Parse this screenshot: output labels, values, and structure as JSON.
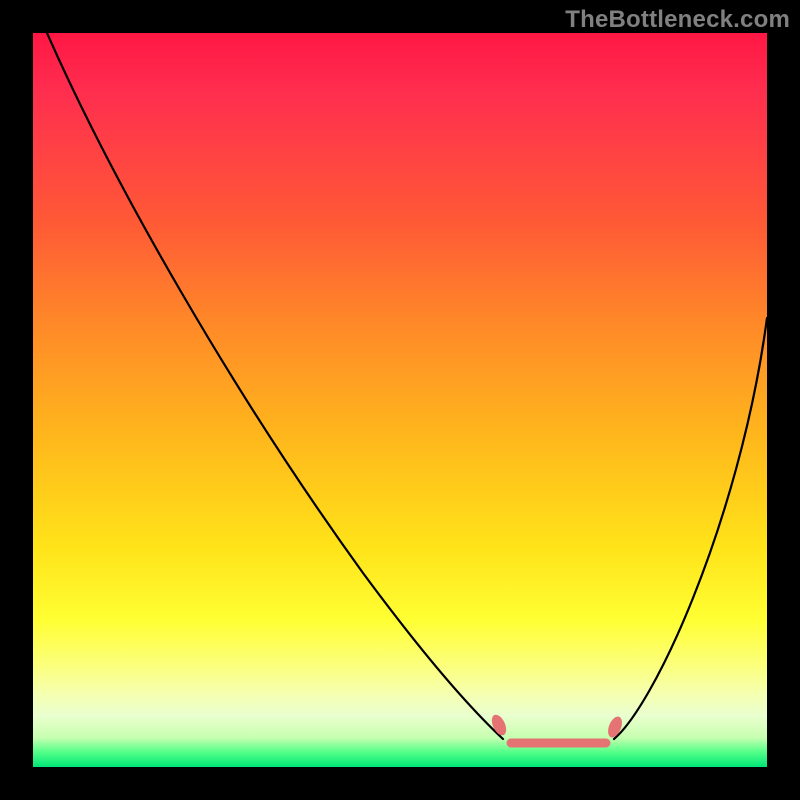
{
  "watermark": "TheBottleneck.com",
  "chart_data": {
    "type": "line",
    "title": "",
    "xlabel": "",
    "ylabel": "",
    "xlim": [
      0,
      100
    ],
    "ylim": [
      0,
      100
    ],
    "grid": false,
    "curves": {
      "left": {
        "description": "descending curve from top-left falling to valley floor",
        "x": [
          2,
          10,
          20,
          30,
          40,
          50,
          58,
          62,
          64
        ],
        "y": [
          100,
          88,
          73,
          58,
          43,
          28,
          14,
          7,
          4
        ]
      },
      "right": {
        "description": "ascending curve rising from valley floor toward upper-right",
        "x": [
          79,
          82,
          86,
          90,
          94,
          98,
          100
        ],
        "y": [
          4,
          8,
          18,
          30,
          42,
          55,
          62
        ]
      },
      "valley_floor": {
        "description": "flat optimal zone at bottom of V",
        "x_start": 64,
        "x_end": 79,
        "y": 3.5
      }
    },
    "markers": {
      "color": "#e57373",
      "left_cap": {
        "x": 63,
        "y": 6.5
      },
      "right_cap": {
        "x": 79.5,
        "y": 6
      },
      "floor_segment": {
        "x_start": 65,
        "x_end": 78,
        "y": 3.5
      }
    },
    "colors": {
      "gradient_top": "#ff1744",
      "gradient_mid": "#ffe319",
      "gradient_bottom": "#00e676",
      "curve": "#000000",
      "marker": "#e57373",
      "frame": "#000000"
    }
  }
}
